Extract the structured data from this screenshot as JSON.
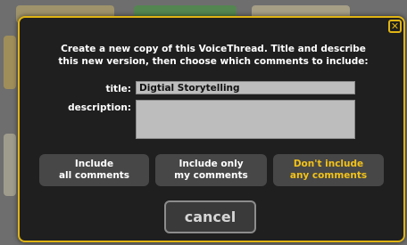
{
  "dialog": {
    "intro_line1": "Create a new copy of this VoiceThread. Title and describe",
    "intro_line2": "this new version, then choose which comments to include:",
    "close_glyph": "✕"
  },
  "form": {
    "title_label": "title:",
    "title_value": "Digtial Storytelling",
    "description_label": "description:",
    "description_value": ""
  },
  "choices": [
    {
      "line1": "Include",
      "line2": "all comments"
    },
    {
      "line1": "Include only",
      "line2": "my comments"
    },
    {
      "line1": "Don't include",
      "line2": "any comments"
    }
  ],
  "cancel_label": "cancel",
  "colors": {
    "accent": "#e0b414",
    "dialog_bg": "#1f1f1f",
    "button_bg": "#474747",
    "highlight_text": "#f2c21a"
  }
}
